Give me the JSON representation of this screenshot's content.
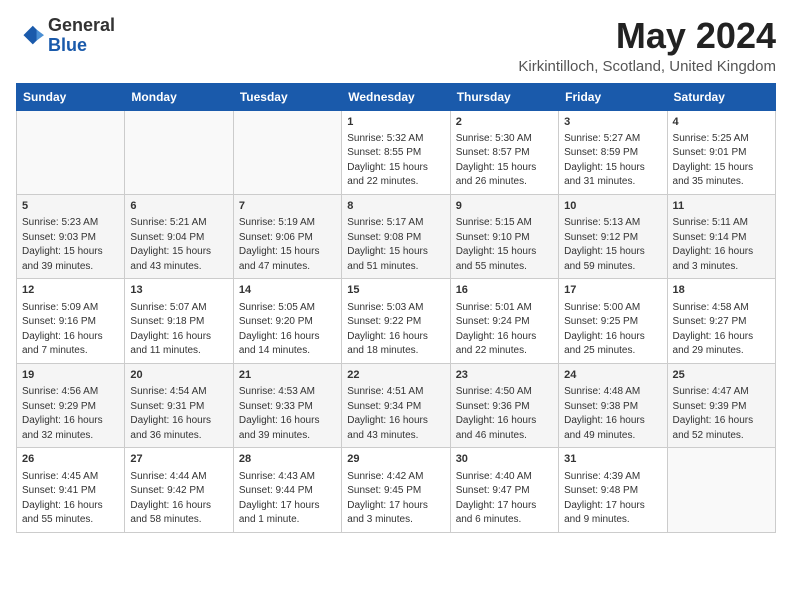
{
  "logo": {
    "general": "General",
    "blue": "Blue"
  },
  "header": {
    "month_title": "May 2024",
    "location": "Kirkintilloch, Scotland, United Kingdom"
  },
  "weekdays": [
    "Sunday",
    "Monday",
    "Tuesday",
    "Wednesday",
    "Thursday",
    "Friday",
    "Saturday"
  ],
  "weeks": [
    [
      {
        "day": "",
        "info": ""
      },
      {
        "day": "",
        "info": ""
      },
      {
        "day": "",
        "info": ""
      },
      {
        "day": "1",
        "info": "Sunrise: 5:32 AM\nSunset: 8:55 PM\nDaylight: 15 hours\nand 22 minutes."
      },
      {
        "day": "2",
        "info": "Sunrise: 5:30 AM\nSunset: 8:57 PM\nDaylight: 15 hours\nand 26 minutes."
      },
      {
        "day": "3",
        "info": "Sunrise: 5:27 AM\nSunset: 8:59 PM\nDaylight: 15 hours\nand 31 minutes."
      },
      {
        "day": "4",
        "info": "Sunrise: 5:25 AM\nSunset: 9:01 PM\nDaylight: 15 hours\nand 35 minutes."
      }
    ],
    [
      {
        "day": "5",
        "info": "Sunrise: 5:23 AM\nSunset: 9:03 PM\nDaylight: 15 hours\nand 39 minutes."
      },
      {
        "day": "6",
        "info": "Sunrise: 5:21 AM\nSunset: 9:04 PM\nDaylight: 15 hours\nand 43 minutes."
      },
      {
        "day": "7",
        "info": "Sunrise: 5:19 AM\nSunset: 9:06 PM\nDaylight: 15 hours\nand 47 minutes."
      },
      {
        "day": "8",
        "info": "Sunrise: 5:17 AM\nSunset: 9:08 PM\nDaylight: 15 hours\nand 51 minutes."
      },
      {
        "day": "9",
        "info": "Sunrise: 5:15 AM\nSunset: 9:10 PM\nDaylight: 15 hours\nand 55 minutes."
      },
      {
        "day": "10",
        "info": "Sunrise: 5:13 AM\nSunset: 9:12 PM\nDaylight: 15 hours\nand 59 minutes."
      },
      {
        "day": "11",
        "info": "Sunrise: 5:11 AM\nSunset: 9:14 PM\nDaylight: 16 hours\nand 3 minutes."
      }
    ],
    [
      {
        "day": "12",
        "info": "Sunrise: 5:09 AM\nSunset: 9:16 PM\nDaylight: 16 hours\nand 7 minutes."
      },
      {
        "day": "13",
        "info": "Sunrise: 5:07 AM\nSunset: 9:18 PM\nDaylight: 16 hours\nand 11 minutes."
      },
      {
        "day": "14",
        "info": "Sunrise: 5:05 AM\nSunset: 9:20 PM\nDaylight: 16 hours\nand 14 minutes."
      },
      {
        "day": "15",
        "info": "Sunrise: 5:03 AM\nSunset: 9:22 PM\nDaylight: 16 hours\nand 18 minutes."
      },
      {
        "day": "16",
        "info": "Sunrise: 5:01 AM\nSunset: 9:24 PM\nDaylight: 16 hours\nand 22 minutes."
      },
      {
        "day": "17",
        "info": "Sunrise: 5:00 AM\nSunset: 9:25 PM\nDaylight: 16 hours\nand 25 minutes."
      },
      {
        "day": "18",
        "info": "Sunrise: 4:58 AM\nSunset: 9:27 PM\nDaylight: 16 hours\nand 29 minutes."
      }
    ],
    [
      {
        "day": "19",
        "info": "Sunrise: 4:56 AM\nSunset: 9:29 PM\nDaylight: 16 hours\nand 32 minutes."
      },
      {
        "day": "20",
        "info": "Sunrise: 4:54 AM\nSunset: 9:31 PM\nDaylight: 16 hours\nand 36 minutes."
      },
      {
        "day": "21",
        "info": "Sunrise: 4:53 AM\nSunset: 9:33 PM\nDaylight: 16 hours\nand 39 minutes."
      },
      {
        "day": "22",
        "info": "Sunrise: 4:51 AM\nSunset: 9:34 PM\nDaylight: 16 hours\nand 43 minutes."
      },
      {
        "day": "23",
        "info": "Sunrise: 4:50 AM\nSunset: 9:36 PM\nDaylight: 16 hours\nand 46 minutes."
      },
      {
        "day": "24",
        "info": "Sunrise: 4:48 AM\nSunset: 9:38 PM\nDaylight: 16 hours\nand 49 minutes."
      },
      {
        "day": "25",
        "info": "Sunrise: 4:47 AM\nSunset: 9:39 PM\nDaylight: 16 hours\nand 52 minutes."
      }
    ],
    [
      {
        "day": "26",
        "info": "Sunrise: 4:45 AM\nSunset: 9:41 PM\nDaylight: 16 hours\nand 55 minutes."
      },
      {
        "day": "27",
        "info": "Sunrise: 4:44 AM\nSunset: 9:42 PM\nDaylight: 16 hours\nand 58 minutes."
      },
      {
        "day": "28",
        "info": "Sunrise: 4:43 AM\nSunset: 9:44 PM\nDaylight: 17 hours\nand 1 minute."
      },
      {
        "day": "29",
        "info": "Sunrise: 4:42 AM\nSunset: 9:45 PM\nDaylight: 17 hours\nand 3 minutes."
      },
      {
        "day": "30",
        "info": "Sunrise: 4:40 AM\nSunset: 9:47 PM\nDaylight: 17 hours\nand 6 minutes."
      },
      {
        "day": "31",
        "info": "Sunrise: 4:39 AM\nSunset: 9:48 PM\nDaylight: 17 hours\nand 9 minutes."
      },
      {
        "day": "",
        "info": ""
      }
    ]
  ]
}
